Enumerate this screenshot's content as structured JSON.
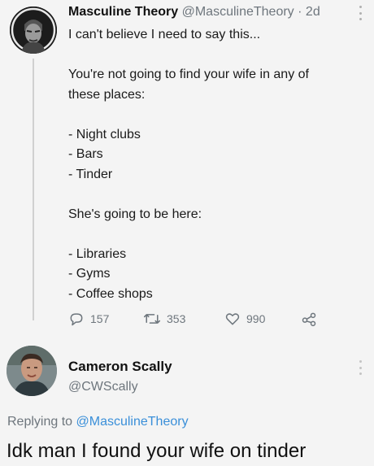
{
  "tweet": {
    "author_name": "Masculine Theory",
    "handle": "@MasculineTheory",
    "separator": "·",
    "time": "2d",
    "lines": [
      "I can't believe I need to say this...",
      "",
      "You're not going to find your wife in any of",
      "these places:",
      "",
      "- Night clubs",
      "- Bars",
      "- Tinder",
      "",
      "She's going to be here:",
      "",
      "- Libraries",
      "- Gyms",
      "- Coffee shops"
    ],
    "replies_count": "157",
    "retweets_count": "353",
    "likes_count": "990"
  },
  "reply": {
    "author_name": "Cameron Scally",
    "handle": "@CWScally",
    "replying_to_prefix": "Replying to",
    "replying_to_handle": "@MasculineTheory",
    "text": "Idk man I found your wife on tinder"
  },
  "icons": {
    "reply": "speech-bubble-icon",
    "retweet": "retweet-icon",
    "like": "heart-icon",
    "share": "share-icon",
    "more": "more-vertical-icon"
  },
  "colors": {
    "background": "#f4f4f4",
    "text": "#1a1a1a",
    "muted": "#6e767d",
    "link": "#3a8fd9"
  }
}
